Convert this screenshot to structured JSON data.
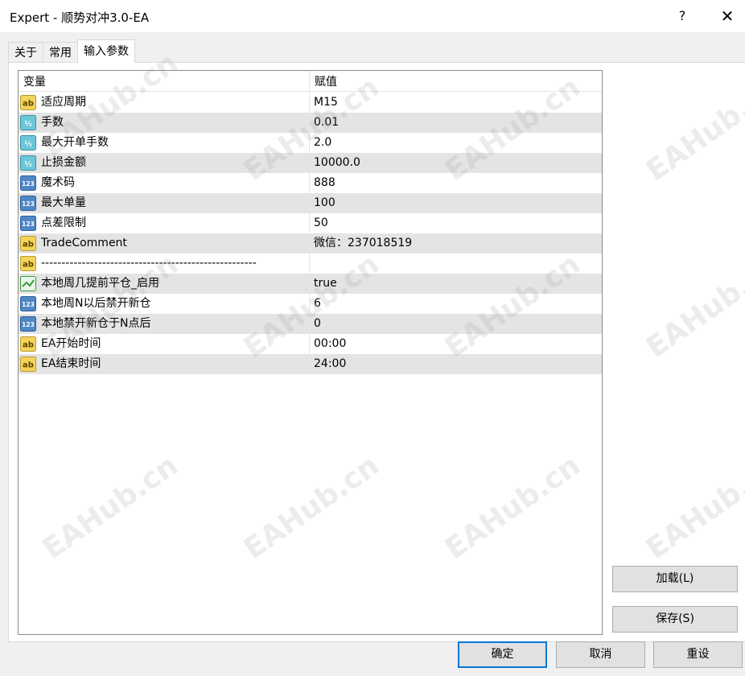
{
  "window": {
    "title": "Expert - 顺势对冲3.0-EA",
    "help": "?",
    "close": "✕"
  },
  "tabs": [
    {
      "label": "关于",
      "active": false
    },
    {
      "label": "常用",
      "active": false
    },
    {
      "label": "输入参数",
      "active": true
    }
  ],
  "grid": {
    "header": {
      "variable": "变量",
      "value": "赋值"
    },
    "rows": [
      {
        "icon": "ab",
        "name": "适应周期",
        "value": "M15"
      },
      {
        "icon": "half",
        "name": "手数",
        "value": "0.01"
      },
      {
        "icon": "half",
        "name": "最大开单手数",
        "value": "2.0"
      },
      {
        "icon": "half",
        "name": "止损金额",
        "value": "10000.0"
      },
      {
        "icon": "123",
        "name": "魔术码",
        "value": "888"
      },
      {
        "icon": "123",
        "name": "最大单量",
        "value": "100"
      },
      {
        "icon": "123",
        "name": "点差限制",
        "value": "50"
      },
      {
        "icon": "ab",
        "name": "TradeComment",
        "value": "微信：237018519"
      },
      {
        "icon": "ab",
        "name": "-----------------------------------------------------",
        "value": ""
      },
      {
        "icon": "bool",
        "name": "本地周几提前平仓_启用",
        "value": "true"
      },
      {
        "icon": "123",
        "name": "本地周N以后禁开新仓",
        "value": "6"
      },
      {
        "icon": "123",
        "name": "本地禁开新仓于N点后",
        "value": "0"
      },
      {
        "icon": "ab",
        "name": "EA开始时间",
        "value": "00:00"
      },
      {
        "icon": "ab",
        "name": "EA结束时间",
        "value": "24:00"
      }
    ]
  },
  "buttons": {
    "load": "加载(L)",
    "save": "保存(S)",
    "ok": "确定",
    "cancel": "取消",
    "reset": "重设"
  },
  "watermark": "EAHub.cn",
  "colors": {
    "accent": "#0078d7",
    "row_alt": "#e4e4e4",
    "icon_ab": "#f3d35a",
    "icon_half": "#6cc6d9",
    "icon_123": "#4f86c6",
    "icon_bool": "#3a9a3a"
  }
}
